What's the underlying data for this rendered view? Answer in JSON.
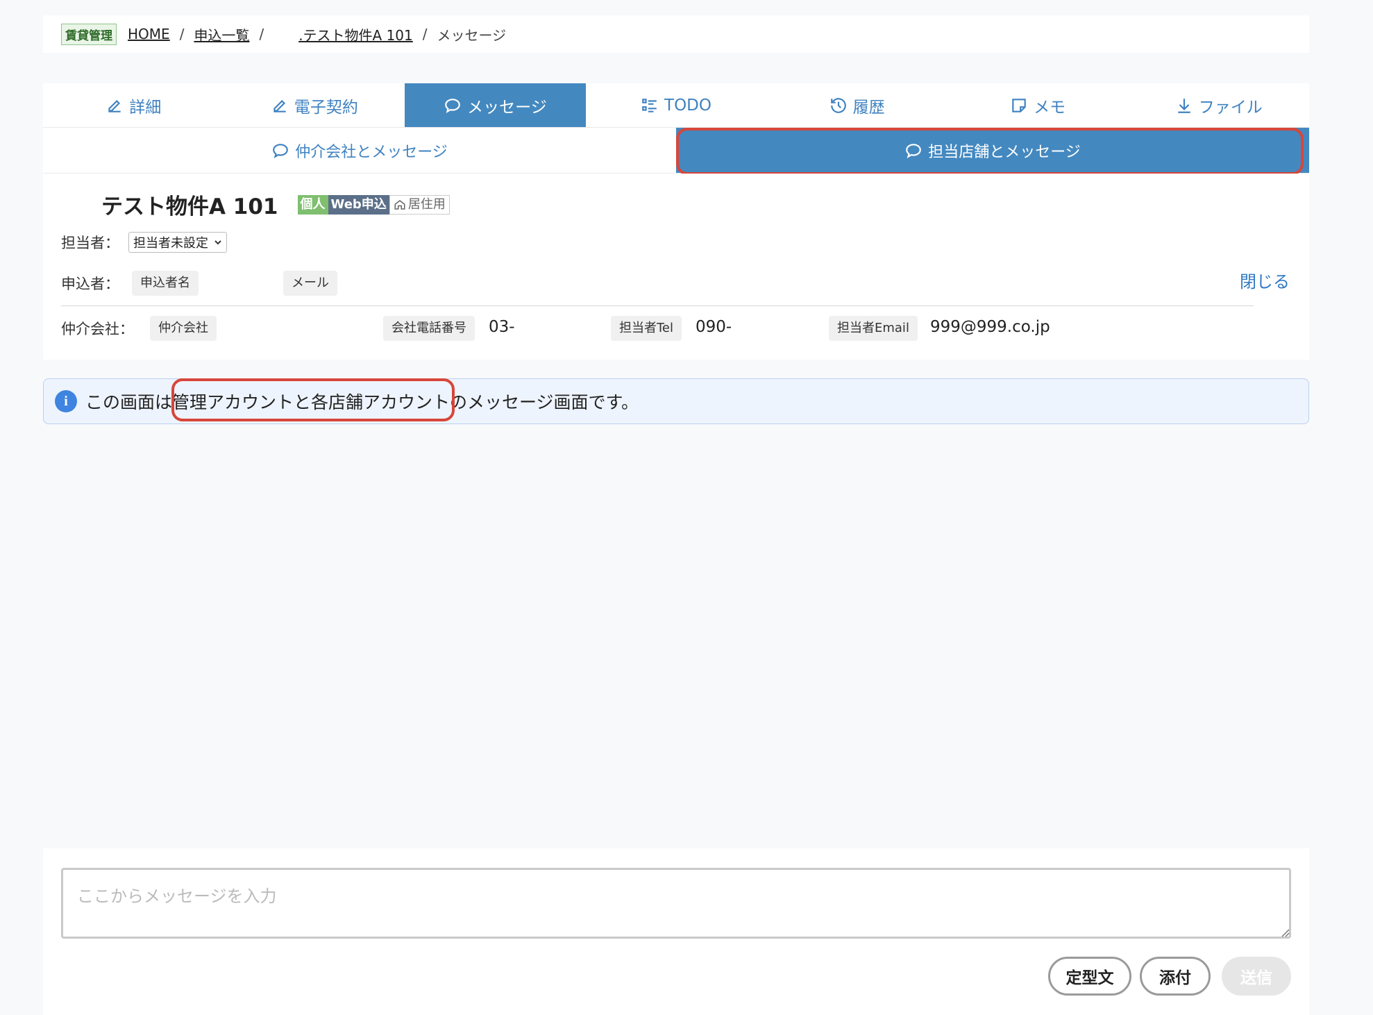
{
  "breadcrumb": {
    "badge": "賃貸管理",
    "home": "HOME",
    "list": "申込一覧",
    "property": ".テスト物件A 101",
    "current": "メッセージ",
    "sep": "/"
  },
  "tabs": [
    {
      "label": "詳細",
      "icon": "pencil-icon"
    },
    {
      "label": "電子契約",
      "icon": "pencil-icon"
    },
    {
      "label": "メッセージ",
      "icon": "chat-bubble-icon",
      "active": true
    },
    {
      "label": "TODO",
      "icon": "checklist-icon"
    },
    {
      "label": "履歴",
      "icon": "history-icon"
    },
    {
      "label": "メモ",
      "icon": "note-icon"
    },
    {
      "label": "ファイル",
      "icon": "download-icon"
    }
  ],
  "subtabs": [
    {
      "label": "仲介会社とメッセージ",
      "icon": "chat-bubble-icon"
    },
    {
      "label": "担当店舗とメッセージ",
      "icon": "chat-bubble-icon",
      "active": true
    }
  ],
  "property": {
    "title": "テスト物件A 101",
    "tags": [
      "個人",
      "Web申込",
      "居住用"
    ]
  },
  "assignee": {
    "label": "担当者：",
    "value": "担当者未設定"
  },
  "applicant": {
    "label": "申込者：",
    "name_chip": "申込者名",
    "mail_chip": "メール"
  },
  "agency": {
    "label": "仲介会社：",
    "company_chip": "仲介会社",
    "tel_chip": "会社電話番号",
    "tel_value": "03-",
    "staff_tel_chip": "担当者Tel",
    "staff_tel_value": "090-",
    "staff_email_chip": "担当者Email",
    "staff_email_value": "999@999.co.jp"
  },
  "close_label": "閉じる",
  "notice": {
    "pre": "この画面は",
    "highlight": "管理アカウントと各店舗アカウント",
    "post": "のメッセージ画面です。"
  },
  "composer": {
    "placeholder": "ここからメッセージを入力",
    "template_btn": "定型文",
    "attach_btn": "添付",
    "send_btn": "送信"
  },
  "colors": {
    "accent": "#4488c0",
    "highlight": "#d7463a",
    "link": "#2f78c3"
  }
}
